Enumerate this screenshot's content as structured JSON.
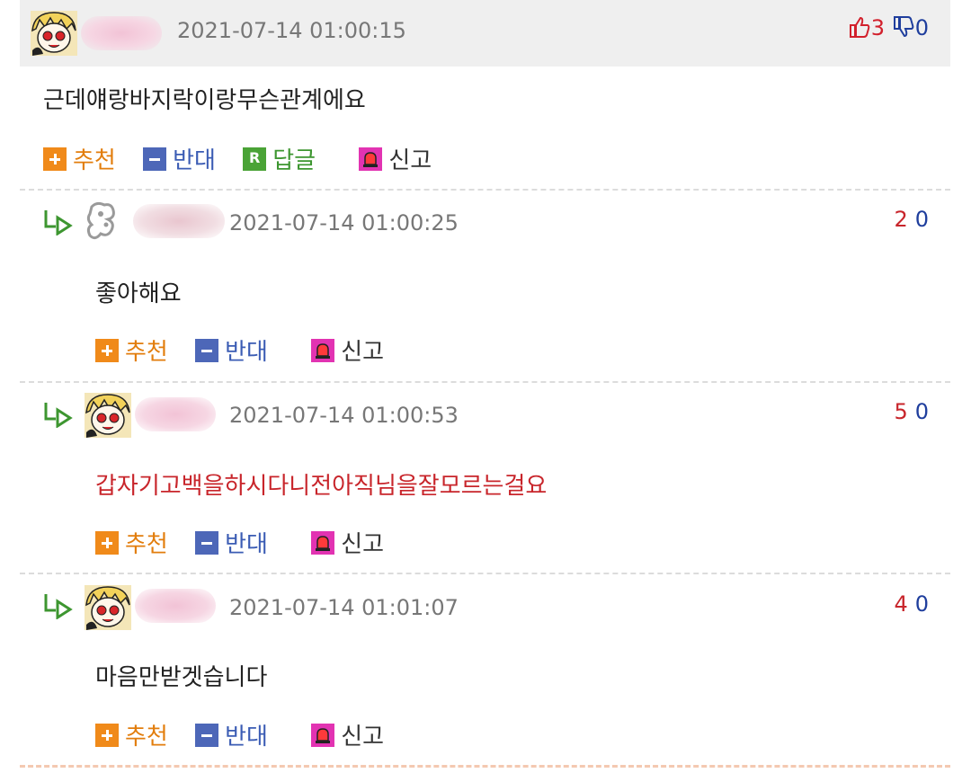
{
  "top_comment": {
    "timestamp": "2021-07-14 01:00:15",
    "upvotes": "3",
    "downvotes": "0",
    "text": "근데얘랑바지락이랑무슨관계에요",
    "actions": {
      "recommend": "추천",
      "oppose": "반대",
      "reply": "답글",
      "report": "신고"
    }
  },
  "replies": [
    {
      "timestamp": "2021-07-14 01:00:25",
      "upvotes": "2",
      "downvotes": "0",
      "text": "좋아해요",
      "actions": {
        "recommend": "추천",
        "oppose": "반대",
        "report": "신고"
      }
    },
    {
      "timestamp": "2021-07-14 01:00:53",
      "upvotes": "5",
      "downvotes": "0",
      "text": "갑자기고백을하시다니전아직님을잘모르는걸요",
      "actions": {
        "recommend": "추천",
        "oppose": "반대",
        "report": "신고"
      }
    },
    {
      "timestamp": "2021-07-14 01:01:07",
      "upvotes": "4",
      "downvotes": "0",
      "text": "마음만받겟습니다",
      "actions": {
        "recommend": "추천",
        "oppose": "반대",
        "report": "신고"
      }
    }
  ],
  "colors": {
    "upvote": "#d2202c",
    "downvote": "#1f3e9d",
    "recommend": "#f08a1a",
    "oppose": "#4d67b8",
    "reply": "#4aa336",
    "report": "#e233b2",
    "highlight_text": "#c8252b"
  },
  "icons": {
    "thumbs_up": "thumbs-up-icon",
    "thumbs_down": "thumbs-down-icon",
    "reply_arrow": "reply-arrow-icon",
    "avatar": "anime-avatar"
  }
}
